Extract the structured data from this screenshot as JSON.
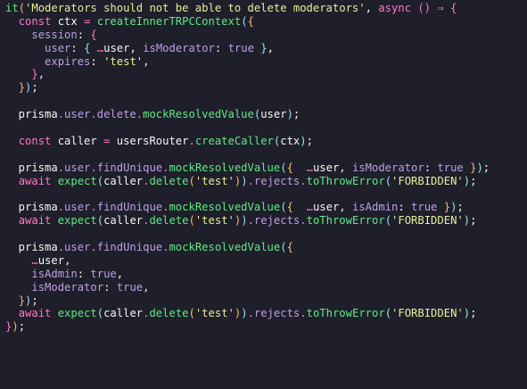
{
  "colors": {
    "background": "#1e1f2a",
    "plain": "#f6f6f4",
    "keyword": "#ff79c6",
    "function": "#62e884",
    "string": "#e7ee98",
    "variable": "#bf9ee6",
    "const": "#97e1f1",
    "punct1": "#ffb86c",
    "punct2": "#ff79c6",
    "punct3": "#97e1f1"
  },
  "editor": {
    "lines": [
      [
        [
          "it",
          "#62e884"
        ],
        [
          "(",
          "#ffb86c"
        ],
        [
          "'Moderators should not be able to delete moderators'",
          "#e7ee98"
        ],
        [
          ", ",
          "#f6f6f4"
        ],
        [
          "async",
          "#ff79c6"
        ],
        [
          " ",
          "#f6f6f4"
        ],
        [
          "()",
          "#ff79c6"
        ],
        [
          " ⇒ ",
          "#ff79c6"
        ],
        [
          "{",
          "#ff79c6"
        ]
      ],
      [
        [
          "  ",
          "#f6f6f4"
        ],
        [
          "const",
          "#ff79c6"
        ],
        [
          " ctx ",
          "#f6f6f4"
        ],
        [
          "=",
          "#ff79c6"
        ],
        [
          " ",
          "#f6f6f4"
        ],
        [
          "createInnerTRPCContext",
          "#62e884"
        ],
        [
          "(",
          "#97e1f1"
        ],
        [
          "{",
          "#ffb86c"
        ]
      ],
      [
        [
          "    ",
          "#f6f6f4"
        ],
        [
          "session",
          "#bf9ee6"
        ],
        [
          ": ",
          "#f6f6f4"
        ],
        [
          "{",
          "#ff79c6"
        ]
      ],
      [
        [
          "      ",
          "#f6f6f4"
        ],
        [
          "user",
          "#bf9ee6"
        ],
        [
          ": ",
          "#f6f6f4"
        ],
        [
          "{",
          "#97e1f1"
        ],
        [
          " ",
          "#f6f6f4"
        ],
        [
          "…",
          "#ff79c6"
        ],
        [
          "user",
          "#f6f6f4"
        ],
        [
          ", ",
          "#f6f6f4"
        ],
        [
          "isModerator",
          "#bf9ee6"
        ],
        [
          ": ",
          "#f6f6f4"
        ],
        [
          "true",
          "#bf9ee6"
        ],
        [
          " ",
          "#f6f6f4"
        ],
        [
          "}",
          "#97e1f1"
        ],
        [
          ",",
          "#f6f6f4"
        ]
      ],
      [
        [
          "      ",
          "#f6f6f4"
        ],
        [
          "expires",
          "#bf9ee6"
        ],
        [
          ": ",
          "#f6f6f4"
        ],
        [
          "'test'",
          "#e7ee98"
        ],
        [
          ",",
          "#f6f6f4"
        ]
      ],
      [
        [
          "    ",
          "#f6f6f4"
        ],
        [
          "}",
          "#ff79c6"
        ],
        [
          ",",
          "#f6f6f4"
        ]
      ],
      [
        [
          "  ",
          "#f6f6f4"
        ],
        [
          "}",
          "#ffb86c"
        ],
        [
          ")",
          "#97e1f1"
        ],
        [
          ";",
          "#f6f6f4"
        ]
      ],
      [],
      [
        [
          "  prisma",
          "#f6f6f4"
        ],
        [
          ".",
          "#ff79c6"
        ],
        [
          "user",
          "#bf9ee6"
        ],
        [
          ".",
          "#ff79c6"
        ],
        [
          "delete",
          "#bf9ee6"
        ],
        [
          ".",
          "#ff79c6"
        ],
        [
          "mockResolvedValue",
          "#62e884"
        ],
        [
          "(",
          "#97e1f1"
        ],
        [
          "user",
          "#f6f6f4"
        ],
        [
          ")",
          "#97e1f1"
        ],
        [
          ";",
          "#f6f6f4"
        ]
      ],
      [],
      [
        [
          "  ",
          "#f6f6f4"
        ],
        [
          "const",
          "#ff79c6"
        ],
        [
          " caller ",
          "#f6f6f4"
        ],
        [
          "=",
          "#ff79c6"
        ],
        [
          " usersRouter",
          "#f6f6f4"
        ],
        [
          ".",
          "#ff79c6"
        ],
        [
          "createCaller",
          "#62e884"
        ],
        [
          "(",
          "#97e1f1"
        ],
        [
          "ctx",
          "#f6f6f4"
        ],
        [
          ")",
          "#97e1f1"
        ],
        [
          ";",
          "#f6f6f4"
        ]
      ],
      [],
      [
        [
          "  prisma",
          "#f6f6f4"
        ],
        [
          ".",
          "#ff79c6"
        ],
        [
          "user",
          "#bf9ee6"
        ],
        [
          ".",
          "#ff79c6"
        ],
        [
          "findUnique",
          "#bf9ee6"
        ],
        [
          ".",
          "#ff79c6"
        ],
        [
          "mockResolvedValue",
          "#62e884"
        ],
        [
          "(",
          "#97e1f1"
        ],
        [
          "{",
          "#ffb86c"
        ],
        [
          "  ",
          "#f6f6f4"
        ],
        [
          "…",
          "#ff79c6"
        ],
        [
          "user",
          "#f6f6f4"
        ],
        [
          ", ",
          "#f6f6f4"
        ],
        [
          "isModerator",
          "#bf9ee6"
        ],
        [
          ": ",
          "#f6f6f4"
        ],
        [
          "true",
          "#bf9ee6"
        ],
        [
          " ",
          "#f6f6f4"
        ],
        [
          "}",
          "#ffb86c"
        ],
        [
          ")",
          "#97e1f1"
        ],
        [
          ";",
          "#f6f6f4"
        ]
      ],
      [
        [
          "  ",
          "#f6f6f4"
        ],
        [
          "await",
          "#ff79c6"
        ],
        [
          " ",
          "#f6f6f4"
        ],
        [
          "expect",
          "#62e884"
        ],
        [
          "(",
          "#97e1f1"
        ],
        [
          "caller",
          "#f6f6f4"
        ],
        [
          ".",
          "#ff79c6"
        ],
        [
          "delete",
          "#62e884"
        ],
        [
          "(",
          "#ffb86c"
        ],
        [
          "'test'",
          "#e7ee98"
        ],
        [
          ")",
          "#ffb86c"
        ],
        [
          ")",
          "#97e1f1"
        ],
        [
          ".",
          "#ff79c6"
        ],
        [
          "rejects",
          "#bf9ee6"
        ],
        [
          ".",
          "#ff79c6"
        ],
        [
          "toThrowError",
          "#62e884"
        ],
        [
          "(",
          "#97e1f1"
        ],
        [
          "'FORBIDDEN'",
          "#e7ee98"
        ],
        [
          ")",
          "#97e1f1"
        ],
        [
          ";",
          "#f6f6f4"
        ]
      ],
      [],
      [
        [
          "  prisma",
          "#f6f6f4"
        ],
        [
          ".",
          "#ff79c6"
        ],
        [
          "user",
          "#bf9ee6"
        ],
        [
          ".",
          "#ff79c6"
        ],
        [
          "findUnique",
          "#bf9ee6"
        ],
        [
          ".",
          "#ff79c6"
        ],
        [
          "mockResolvedValue",
          "#62e884"
        ],
        [
          "(",
          "#97e1f1"
        ],
        [
          "{",
          "#ffb86c"
        ],
        [
          "  ",
          "#f6f6f4"
        ],
        [
          "…",
          "#ff79c6"
        ],
        [
          "user",
          "#f6f6f4"
        ],
        [
          ", ",
          "#f6f6f4"
        ],
        [
          "isAdmin",
          "#bf9ee6"
        ],
        [
          ": ",
          "#f6f6f4"
        ],
        [
          "true",
          "#bf9ee6"
        ],
        [
          " ",
          "#f6f6f4"
        ],
        [
          "}",
          "#ffb86c"
        ],
        [
          ")",
          "#97e1f1"
        ],
        [
          ";",
          "#f6f6f4"
        ]
      ],
      [
        [
          "  ",
          "#f6f6f4"
        ],
        [
          "await",
          "#ff79c6"
        ],
        [
          " ",
          "#f6f6f4"
        ],
        [
          "expect",
          "#62e884"
        ],
        [
          "(",
          "#97e1f1"
        ],
        [
          "caller",
          "#f6f6f4"
        ],
        [
          ".",
          "#ff79c6"
        ],
        [
          "delete",
          "#62e884"
        ],
        [
          "(",
          "#ffb86c"
        ],
        [
          "'test'",
          "#e7ee98"
        ],
        [
          ")",
          "#ffb86c"
        ],
        [
          ")",
          "#97e1f1"
        ],
        [
          ".",
          "#ff79c6"
        ],
        [
          "rejects",
          "#bf9ee6"
        ],
        [
          ".",
          "#ff79c6"
        ],
        [
          "toThrowError",
          "#62e884"
        ],
        [
          "(",
          "#97e1f1"
        ],
        [
          "'FORBIDDEN'",
          "#e7ee98"
        ],
        [
          ")",
          "#97e1f1"
        ],
        [
          ";",
          "#f6f6f4"
        ]
      ],
      [],
      [
        [
          "  prisma",
          "#f6f6f4"
        ],
        [
          ".",
          "#ff79c6"
        ],
        [
          "user",
          "#bf9ee6"
        ],
        [
          ".",
          "#ff79c6"
        ],
        [
          "findUnique",
          "#bf9ee6"
        ],
        [
          ".",
          "#ff79c6"
        ],
        [
          "mockResolvedValue",
          "#62e884"
        ],
        [
          "(",
          "#97e1f1"
        ],
        [
          "{",
          "#ffb86c"
        ]
      ],
      [
        [
          "    ",
          "#f6f6f4"
        ],
        [
          "…",
          "#ff79c6"
        ],
        [
          "user",
          "#f6f6f4"
        ],
        [
          ",",
          "#f6f6f4"
        ]
      ],
      [
        [
          "    ",
          "#f6f6f4"
        ],
        [
          "isAdmin",
          "#bf9ee6"
        ],
        [
          ": ",
          "#f6f6f4"
        ],
        [
          "true",
          "#bf9ee6"
        ],
        [
          ",",
          "#f6f6f4"
        ]
      ],
      [
        [
          "    ",
          "#f6f6f4"
        ],
        [
          "isModerator",
          "#bf9ee6"
        ],
        [
          ": ",
          "#f6f6f4"
        ],
        [
          "true",
          "#bf9ee6"
        ],
        [
          ",",
          "#f6f6f4"
        ]
      ],
      [
        [
          "  ",
          "#f6f6f4"
        ],
        [
          "}",
          "#ffb86c"
        ],
        [
          ")",
          "#97e1f1"
        ],
        [
          ";",
          "#f6f6f4"
        ]
      ],
      [
        [
          "  ",
          "#f6f6f4"
        ],
        [
          "await",
          "#ff79c6"
        ],
        [
          " ",
          "#f6f6f4"
        ],
        [
          "expect",
          "#62e884"
        ],
        [
          "(",
          "#97e1f1"
        ],
        [
          "caller",
          "#f6f6f4"
        ],
        [
          ".",
          "#ff79c6"
        ],
        [
          "delete",
          "#62e884"
        ],
        [
          "(",
          "#ffb86c"
        ],
        [
          "'test'",
          "#e7ee98"
        ],
        [
          ")",
          "#ffb86c"
        ],
        [
          ")",
          "#97e1f1"
        ],
        [
          ".",
          "#ff79c6"
        ],
        [
          "rejects",
          "#bf9ee6"
        ],
        [
          ".",
          "#ff79c6"
        ],
        [
          "toThrowError",
          "#62e884"
        ],
        [
          "(",
          "#97e1f1"
        ],
        [
          "'FORBIDDEN'",
          "#e7ee98"
        ],
        [
          ")",
          "#97e1f1"
        ],
        [
          ";",
          "#f6f6f4"
        ]
      ],
      [
        [
          "}",
          "#ff79c6"
        ],
        [
          ")",
          "#ffb86c"
        ],
        [
          ";",
          "#f6f6f4"
        ]
      ]
    ]
  }
}
